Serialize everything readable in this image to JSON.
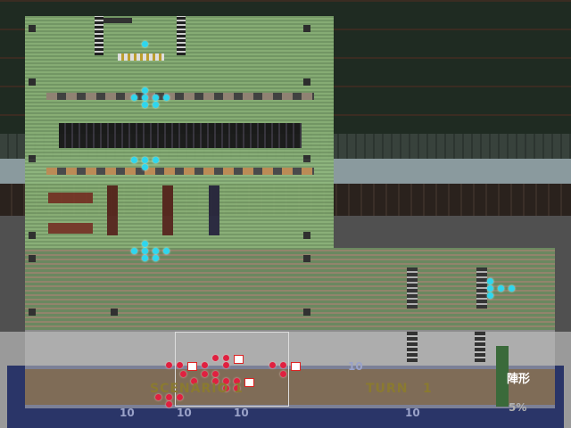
{
  "hud": {
    "scenario_label": "SCENARIO 1",
    "turn_label": "TURN",
    "turn_value": "1",
    "percent": "5%",
    "unit_counts": [
      "10",
      "10",
      "10",
      "10",
      "10"
    ],
    "corner_glyph": "陣形"
  },
  "colors": {
    "ally_unit": "#2fd6ee",
    "enemy_unit": "#e02040",
    "hud_panel": "#2a3568"
  }
}
